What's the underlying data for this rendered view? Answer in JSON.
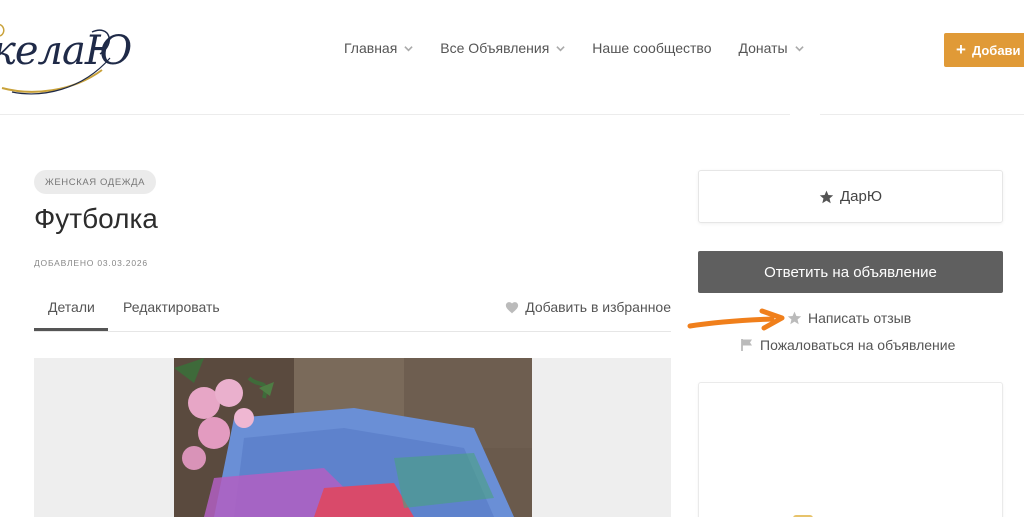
{
  "header": {
    "logo_text": "келаЮ",
    "nav": [
      {
        "label": "Главная",
        "has_dropdown": true
      },
      {
        "label": "Все Объявления",
        "has_dropdown": true
      },
      {
        "label": "Наше сообщество",
        "has_dropdown": false
      },
      {
        "label": "Донаты",
        "has_dropdown": true
      }
    ],
    "add_button_label": "Добави",
    "add_button_color": "#e09a37"
  },
  "listing": {
    "category": "ЖЕНСКАЯ ОДЕЖДА",
    "title": "Футболка",
    "added": "ДОБАВЛЕНО 03.03.2026",
    "tabs": [
      {
        "label": "Детали",
        "active": true
      },
      {
        "label": "Редактировать",
        "active": false
      }
    ],
    "favorite_label": "Добавить в избранное"
  },
  "sidebar": {
    "author_name": "ДарЮ",
    "reply_label": "Ответить на объявление",
    "review_label": "Написать отзыв",
    "report_label": "Пожаловаться на объявление"
  },
  "colors": {
    "annotation_arrow": "#f07f1b",
    "reply_button": "#5f5f5f"
  }
}
